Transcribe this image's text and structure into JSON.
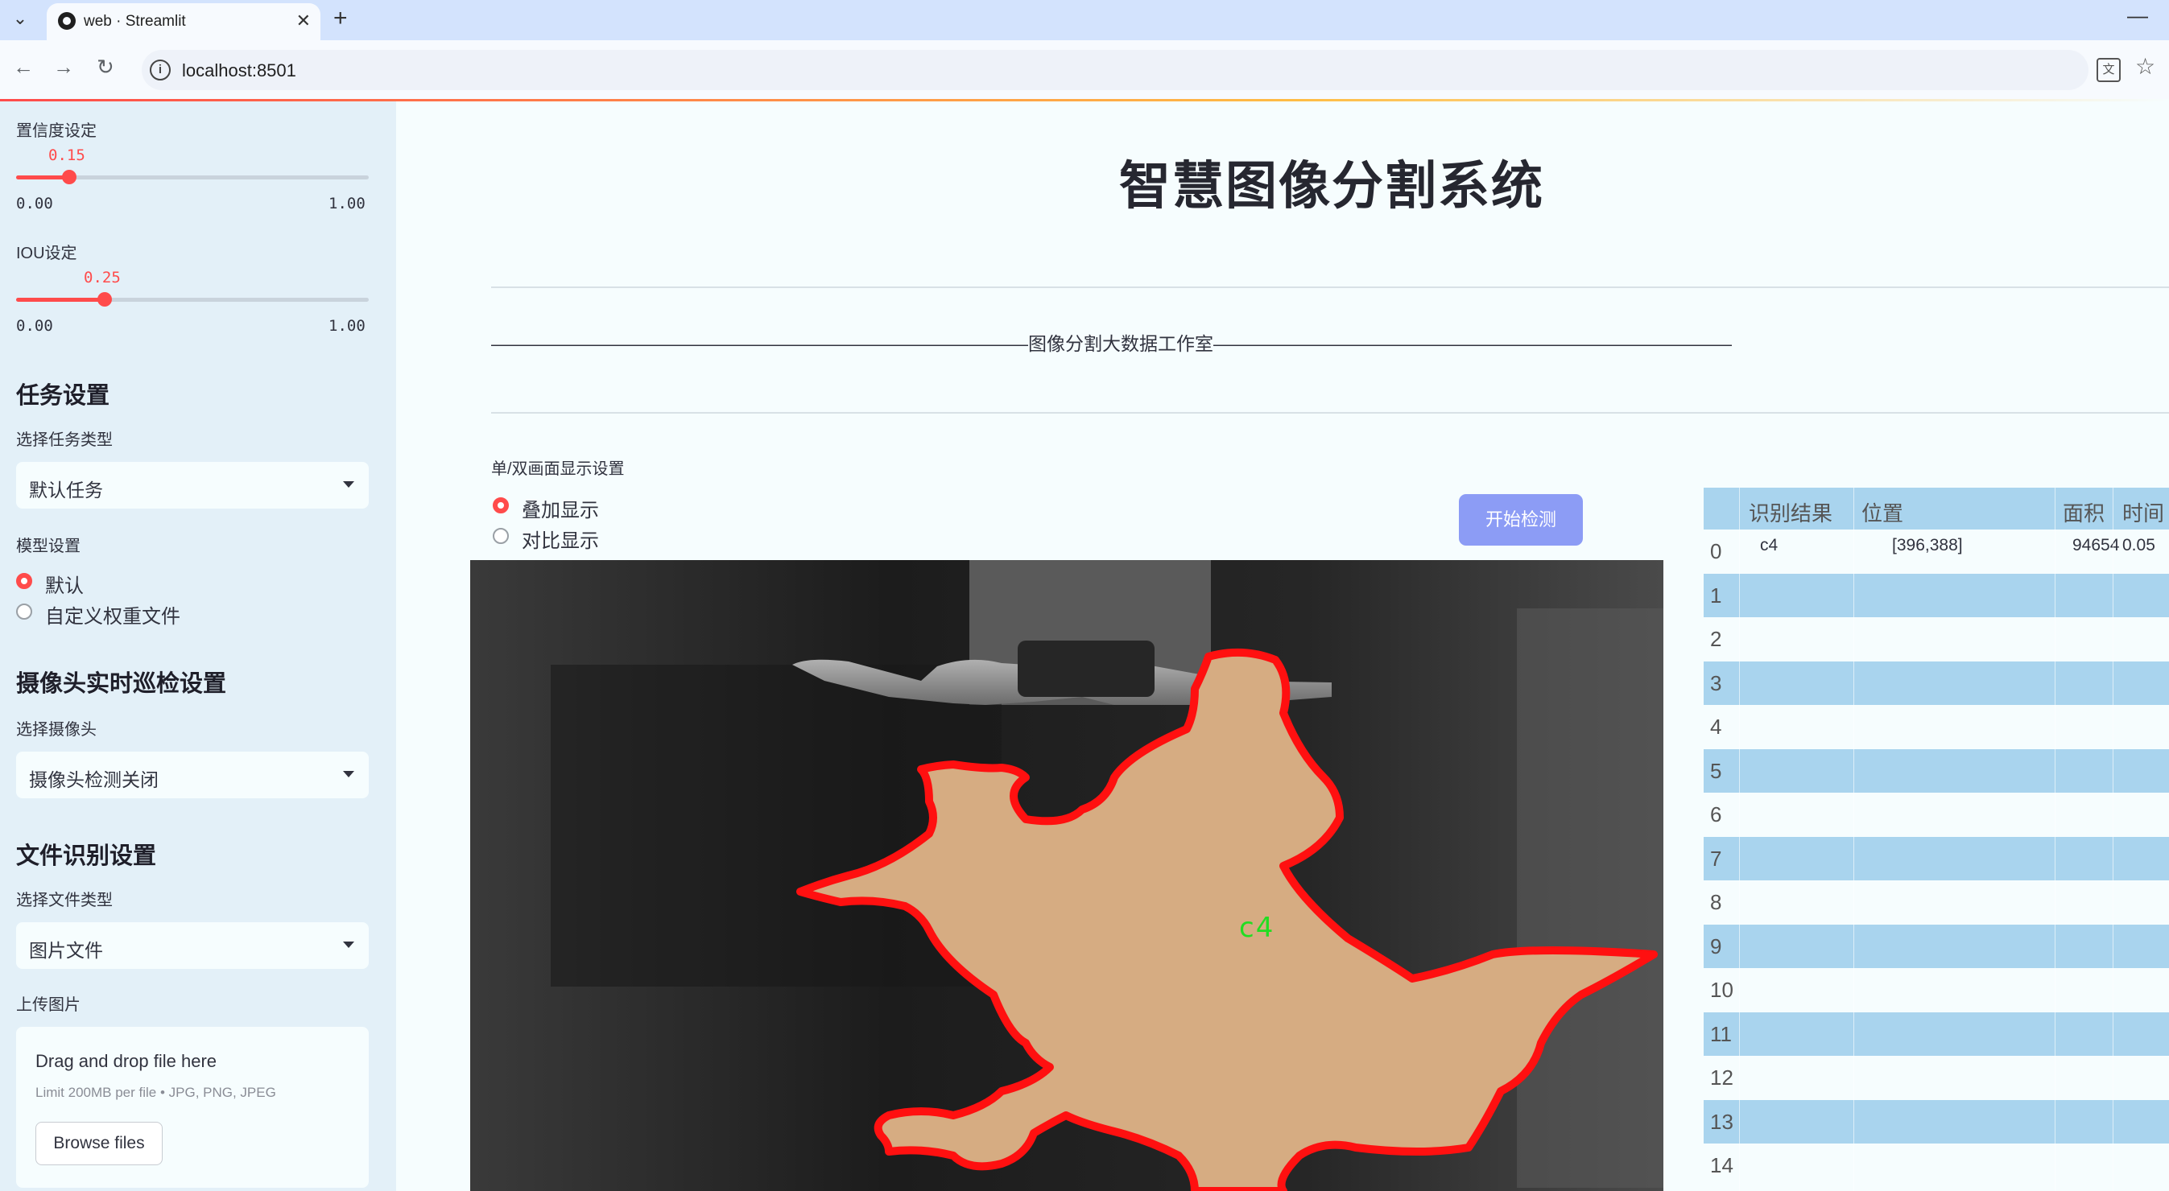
{
  "browser": {
    "tab_title": "web · Streamlit",
    "url": "localhost:8501"
  },
  "sidebar": {
    "conf": {
      "label": "置信度设定",
      "value": "0.15",
      "value_num": 0.15,
      "min": "0.00",
      "max": "1.00"
    },
    "iou": {
      "label": "IOU设定",
      "value": "0.25",
      "value_num": 0.25,
      "min": "0.00",
      "max": "1.00"
    },
    "task": {
      "heading": "任务设置",
      "select_label": "选择任务类型",
      "selected": "默认任务"
    },
    "model": {
      "label": "模型设置",
      "options": [
        "默认",
        "自定义权重文件"
      ],
      "selected_index": 0
    },
    "camera": {
      "heading": "摄像头实时巡检设置",
      "select_label": "选择摄像头",
      "selected": "摄像头检测关闭"
    },
    "file": {
      "heading": "文件识别设置",
      "select_label": "选择文件类型",
      "selected": "图片文件",
      "upload_label": "上传图片"
    },
    "uploader": {
      "title": "Drag and drop file here",
      "limit": "Limit 200MB per file • JPG, PNG, JPEG",
      "browse": "Browse files"
    }
  },
  "main": {
    "title": "智慧图像分割系统",
    "subtitle": "—————————————————————————————图像分割大数据工作室————————————————————————————",
    "display_mode": {
      "label": "单/双画面显示设置",
      "options": [
        "叠加显示",
        "对比显示"
      ],
      "selected_index": 0
    },
    "start_button": "开始检测",
    "detection_label": "c4"
  },
  "table": {
    "headers": [
      "识别结果",
      "位置",
      "面积",
      "时间"
    ],
    "row_indices": [
      "0",
      "1",
      "2",
      "3",
      "4",
      "5",
      "6",
      "7",
      "8",
      "9",
      "10",
      "11",
      "12",
      "13",
      "14"
    ],
    "rows": [
      {
        "result": "c4",
        "position": "[396,388]",
        "area": "94654",
        "time": "0.05"
      }
    ]
  },
  "colors": {
    "accent": "#ff4b4b",
    "button": "#8c9cf5",
    "sidebar_bg": "#e3f0f8",
    "table_stripe": "#a9d4ee",
    "mask_fill": "#d6ac82",
    "mask_outline": "#ff1010",
    "label_color": "#22dd22"
  }
}
